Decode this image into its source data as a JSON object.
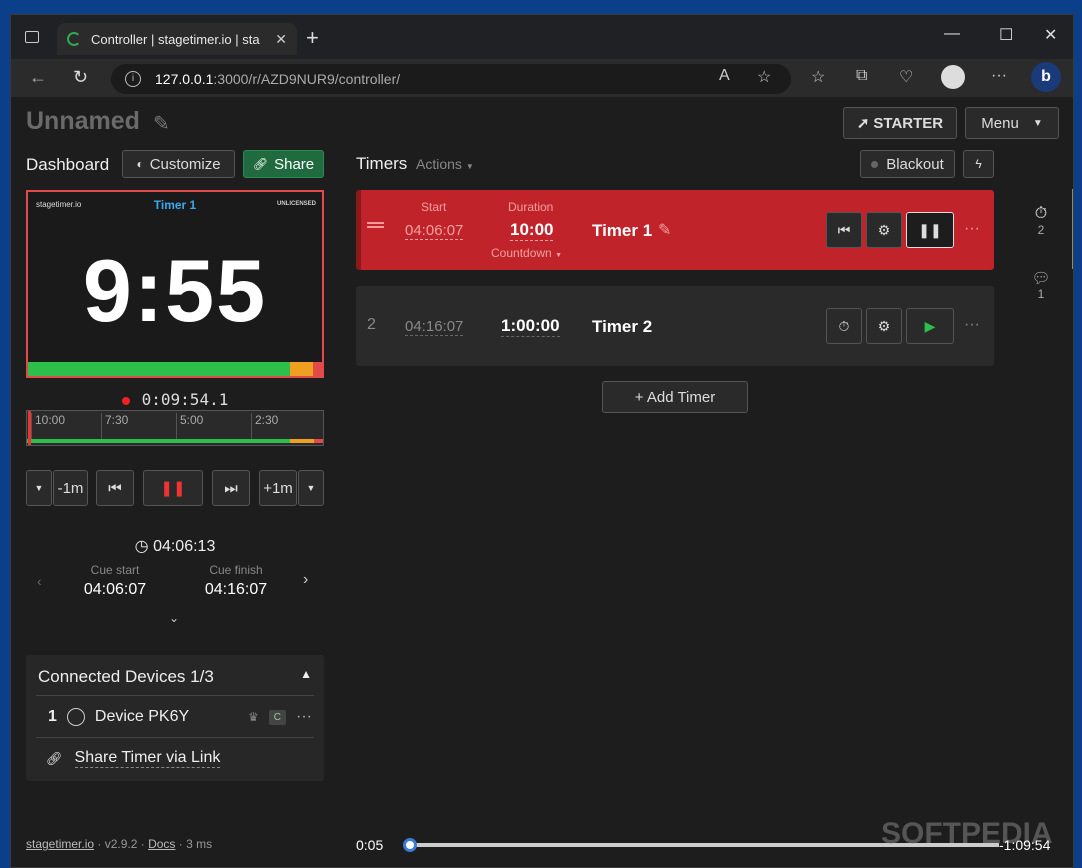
{
  "browser": {
    "tab_title": "Controller | stagetimer.io | sta",
    "url_host": "127.0.0.1",
    "url_rest": ":3000/r/AZD9NUR9/controller/"
  },
  "room": {
    "title": "Unnamed",
    "starter_label": "STARTER",
    "menu_label": "Menu"
  },
  "dashboard": {
    "label": "Dashboard",
    "customize": "Customize",
    "share": "Share"
  },
  "preview": {
    "logo": "stagetimer.io",
    "timer_name": "Timer 1",
    "license": "UNLICENSED",
    "time": "9:55",
    "progress": 0.88
  },
  "elapsed": "0:09:54.1",
  "ruler_ticks": [
    "10:00",
    "7:30",
    "5:00",
    "2:30"
  ],
  "controls": {
    "minus": "-1m",
    "plus": "+1m"
  },
  "clock": "04:06:13",
  "cue": {
    "start_label": "Cue start",
    "start": "04:06:07",
    "finish_label": "Cue finish",
    "finish": "04:16:07"
  },
  "devices": {
    "title": "Connected Devices",
    "count": "1/3",
    "items": [
      {
        "num": "1",
        "name": "Device PK6Y",
        "badge": "C"
      }
    ],
    "share_link": "Share Timer via Link"
  },
  "footer": {
    "site": "stagetimer.io",
    "version": "· v2.9.2 ·",
    "docs": "Docs",
    "latency": "· 3 ms"
  },
  "timers": {
    "label": "Timers",
    "actions": "Actions",
    "blackout": "Blackout",
    "add": "+ Add Timer",
    "items": [
      {
        "num": "",
        "start_label": "Start",
        "start": "04:06:07",
        "duration_label": "Duration",
        "duration": "10:00",
        "mode": "Countdown",
        "name": "Timer 1"
      },
      {
        "num": "2",
        "start": "04:16:07",
        "duration": "1:00:00",
        "name": "Timer 2"
      }
    ]
  },
  "sidebar": {
    "timers_count": "2",
    "messages_count": "1"
  },
  "playback": {
    "elapsed": "0:05",
    "remaining": "-1:09:54",
    "progress": 0.01
  },
  "watermark": "SOFTPEDIA"
}
